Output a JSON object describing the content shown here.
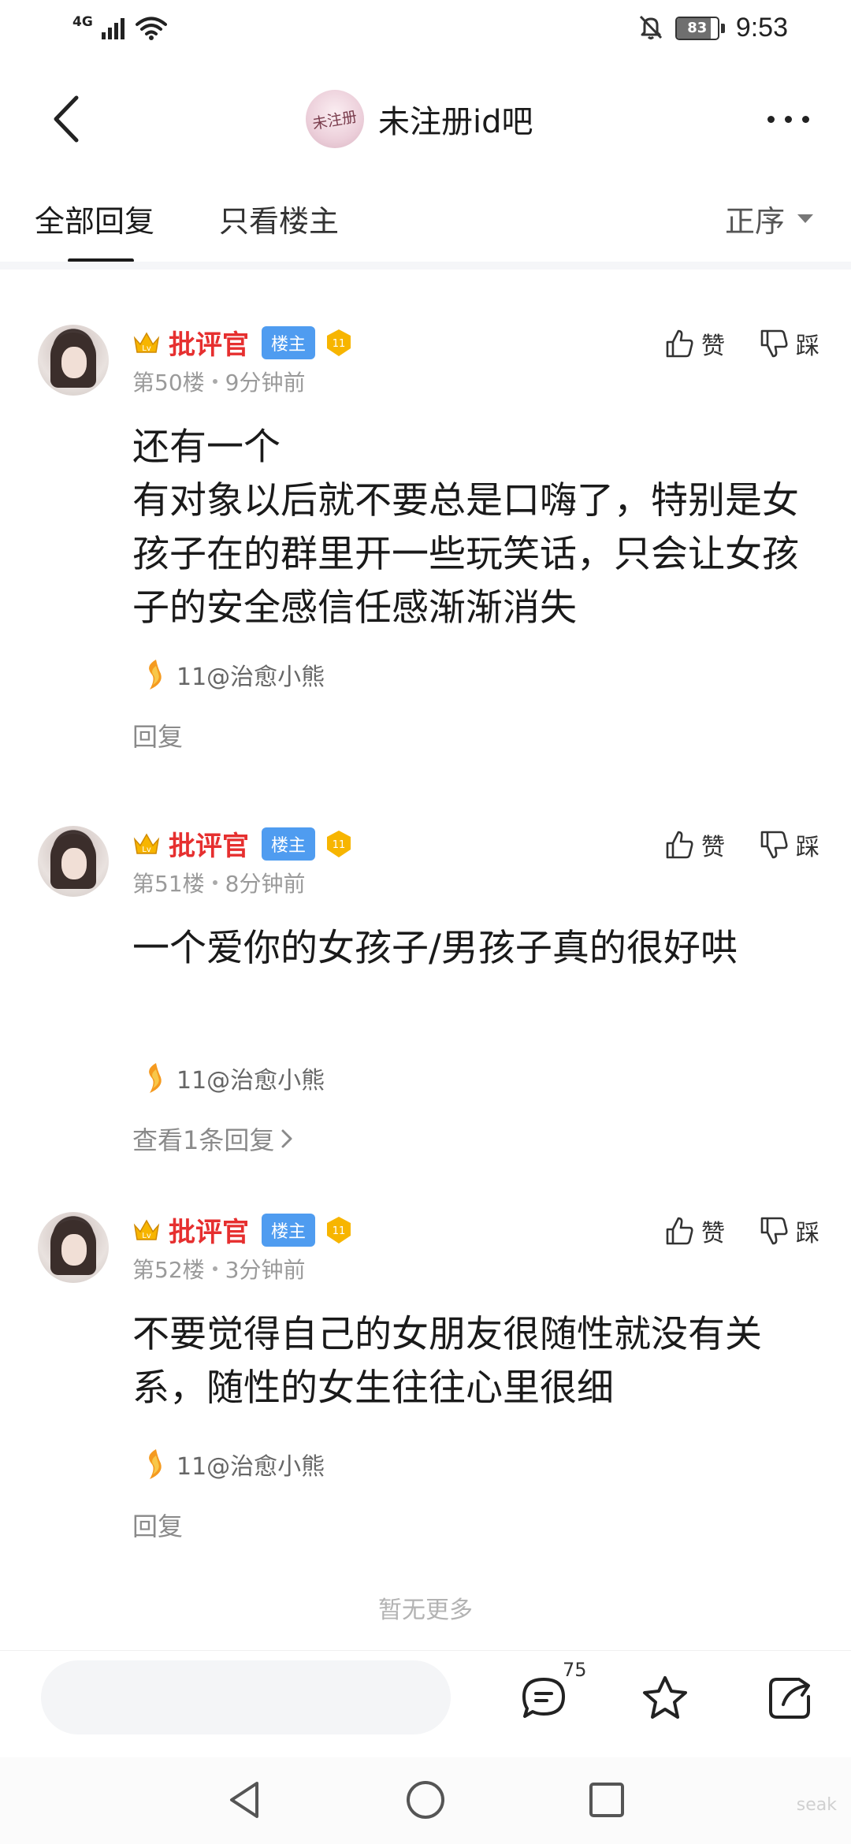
{
  "status_bar": {
    "network": "4G",
    "battery": "83",
    "battery_level": 0.83,
    "time": "9:53"
  },
  "header": {
    "forum_avatar_text": "未注册",
    "forum_name": "未注册id吧"
  },
  "tabs": {
    "all_replies": "全部回复",
    "owner_only": "只看楼主",
    "sort": "正序"
  },
  "posts": [
    {
      "username": "批评官",
      "owner_badge": "楼主",
      "level": "11",
      "floor": "第50楼",
      "time": "9分钟前",
      "like": "赞",
      "dislike": "踩",
      "content": "还有一个\n有对象以后就不要总是口嗨了，特别是女孩子在的群里开一些玩笑话，只会让女孩子的安全感信任感渐渐消失",
      "signature": "11@治愈小熊",
      "reply_link": "回复"
    },
    {
      "username": "批评官",
      "owner_badge": "楼主",
      "level": "11",
      "floor": "第51楼",
      "time": "8分钟前",
      "like": "赞",
      "dislike": "踩",
      "content": "一个爱你的女孩子/男孩子真的很好哄",
      "signature": "11@治愈小熊",
      "reply_link": "查看1条回复"
    },
    {
      "username": "批评官",
      "owner_badge": "楼主",
      "level": "11",
      "floor": "第52楼",
      "time": "3分钟前",
      "like": "赞",
      "dislike": "踩",
      "content": "不要觉得自己的女朋友很随性就没有关系，随性的女生往往心里很细",
      "signature": "11@治愈小熊",
      "reply_link": "回复"
    }
  ],
  "footer": {
    "no_more": "暂无更多",
    "comment_count": "75"
  },
  "watermark": "seak",
  "colors": {
    "username": "#e62f2f",
    "owner_badge": "#4f9cf0",
    "level_badge": "#f7b500"
  }
}
